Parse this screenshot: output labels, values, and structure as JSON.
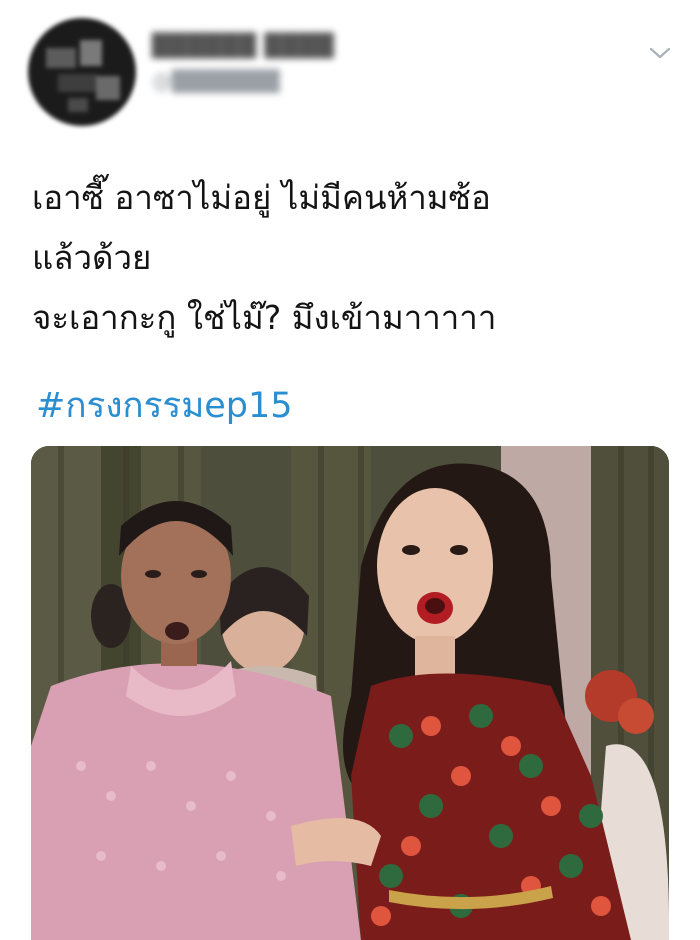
{
  "tweet": {
    "text_lines": [
      "เอาซี๊ อาซาไม่อยู่ ไม่มีคนห้ามซ้อ",
      "แล้วด้วย",
      "จะเอากะกู ใช่ไม๊? มึงเข้ามาาาาา"
    ],
    "hashtag": "#กรงกรรมep15"
  },
  "icons": {
    "menu": "chevron-down-icon",
    "avatar": "blurred-avatar"
  }
}
